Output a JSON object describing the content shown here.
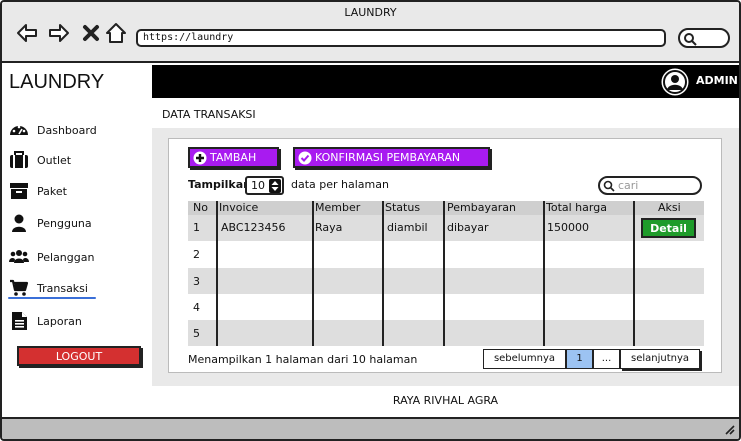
{
  "window": {
    "title": "LAUNDRY",
    "url": "https://laundry"
  },
  "sidebar": {
    "brand": "LAUNDRY",
    "items": [
      {
        "label": "Dashboard",
        "icon": "dashboard-icon"
      },
      {
        "label": "Outlet",
        "icon": "outlet-icon"
      },
      {
        "label": "Paket",
        "icon": "package-icon"
      },
      {
        "label": "Pengguna",
        "icon": "user-icon"
      },
      {
        "label": "Pelanggan",
        "icon": "customers-icon"
      },
      {
        "label": "Transaksi",
        "icon": "cart-icon"
      },
      {
        "label": "Laporan",
        "icon": "report-icon"
      }
    ],
    "active": "Transaksi",
    "logout": "LOGOUT"
  },
  "topbar": {
    "user": "ADMIN"
  },
  "page": {
    "title": "DATA TRANSAKSI"
  },
  "actions": {
    "add": "TAMBAH",
    "confirm": "KONFIRMASI PEMBAYARAN"
  },
  "controls": {
    "show_label": "Tampilkan",
    "page_size": "10",
    "per_page_label": "data per halaman",
    "search_placeholder": "cari"
  },
  "table": {
    "headers": [
      "No",
      "Invoice",
      "Member",
      "Status",
      "Pembayaran",
      "Total harga",
      "Aksi"
    ],
    "rows": [
      {
        "no": "1",
        "invoice": "ABC123456",
        "member": "Raya",
        "status": "diambil",
        "payment": "dibayar",
        "total": "150000",
        "action": "Detail"
      },
      {
        "no": "2",
        "invoice": "",
        "member": "",
        "status": "",
        "payment": "",
        "total": "",
        "action": ""
      },
      {
        "no": "3",
        "invoice": "",
        "member": "",
        "status": "",
        "payment": "",
        "total": "",
        "action": ""
      },
      {
        "no": "4",
        "invoice": "",
        "member": "",
        "status": "",
        "payment": "",
        "total": "",
        "action": ""
      },
      {
        "no": "5",
        "invoice": "",
        "member": "",
        "status": "",
        "payment": "",
        "total": "",
        "action": ""
      }
    ]
  },
  "pagination": {
    "info": "Menampilkan 1 halaman dari 10 halaman",
    "prev": "sebelumnya",
    "current": "1",
    "ellipsis": "...",
    "next": "selanjutnya"
  },
  "footer": {
    "text": "RAYA RIVHAL AGRA"
  },
  "colors": {
    "purple": "#a81bf0",
    "logout": "#d43030",
    "detail": "#1e9b2a",
    "current_page": "#9cc3f2"
  }
}
